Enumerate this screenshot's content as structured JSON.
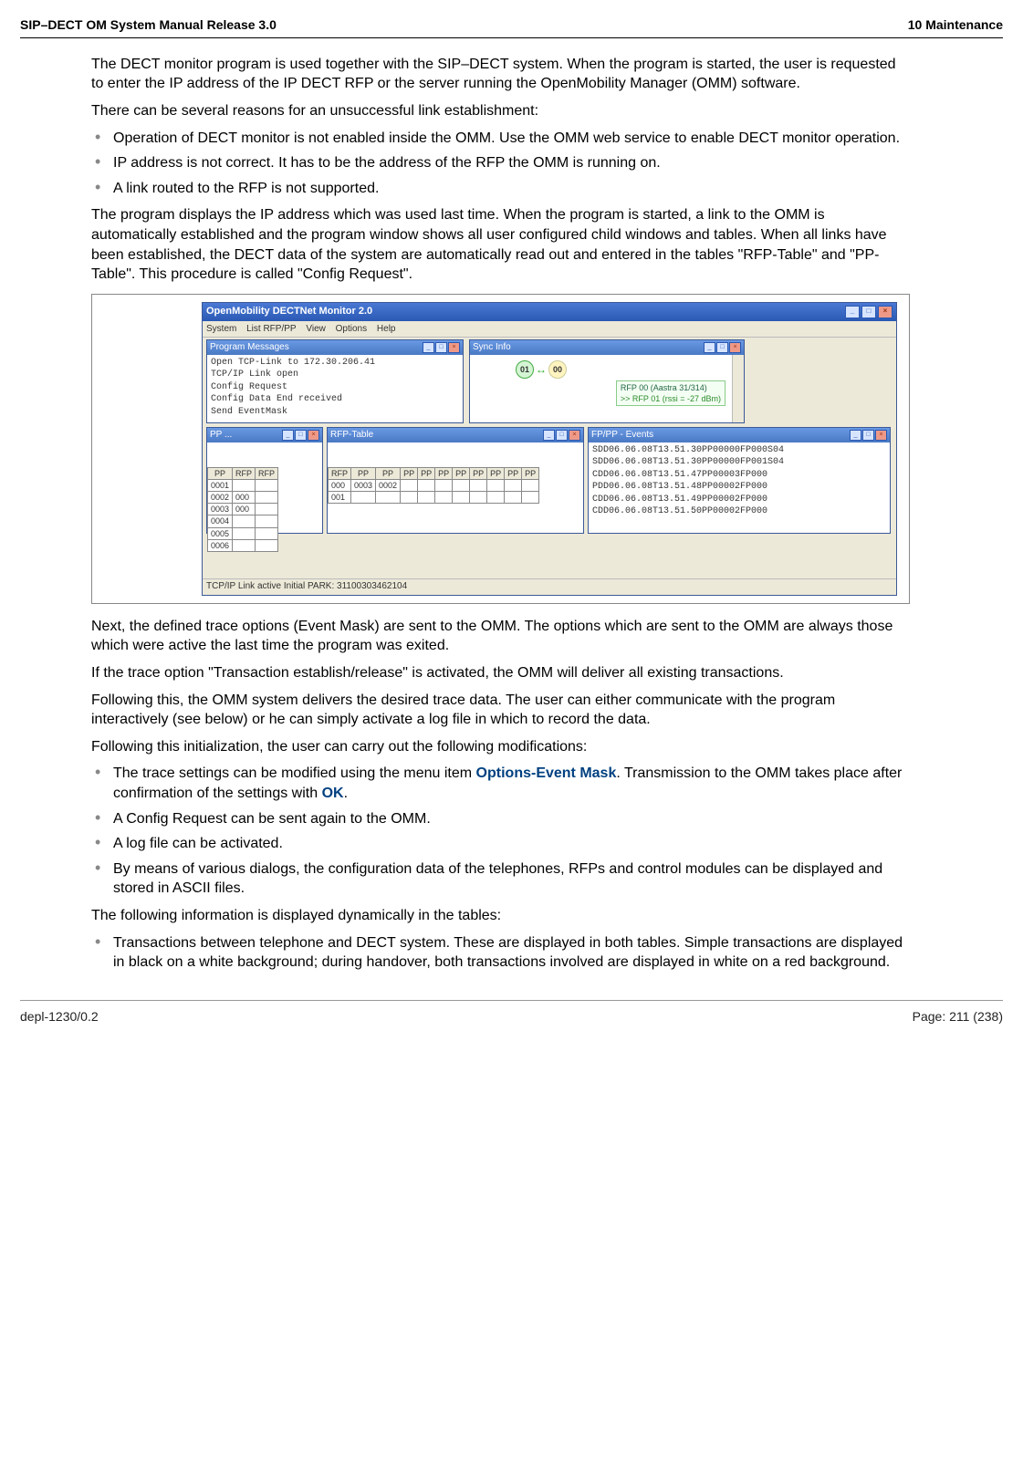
{
  "header": {
    "left": "SIP–DECT OM System Manual Release 3.0",
    "right": "10 Maintenance"
  },
  "footer": {
    "left": "depl-1230/0.2",
    "right": "Page: 211 (238)"
  },
  "p1": "The DECT monitor program is used together with the SIP–DECT system. When the program is started, the user is requested to enter the IP address of the IP DECT RFP or the server running the OpenMobility Manager (OMM) software.",
  "p2": "There can be several reasons for an unsuccessful link establishment:",
  "bullets1": {
    "a": "Operation of DECT monitor is not enabled inside the OMM. Use the OMM web service to enable DECT monitor operation.",
    "b": "IP address is not correct. It has to be the address of the RFP the OMM is running on.",
    "c": "A link routed to the RFP is not supported."
  },
  "p3": "The program displays the IP address which was used last time. When the program is started, a link to the OMM is automatically established and the program window shows all user configured child windows and tables. When all links have been established, the DECT data of the system are automatically read out and entered in the tables \"RFP-Table\" and \"PP-Table\". This procedure is called \"Config Request\".",
  "p4": "Next, the defined trace options (Event Mask) are sent to the OMM. The options which are sent to the OMM are always those which were active the last time the program was exited.",
  "p5": "If the trace option \"Transaction establish/release\" is activated, the OMM will deliver all existing transactions.",
  "p6": "Following this, the OMM system delivers the desired trace data. The user can either communicate with the program interactively (see below) or he can simply activate a log file in which to record the data.",
  "p7": "Following this initialization, the user can carry out the following modifications:",
  "bullets2": {
    "a_pre": "The trace settings can be modified using the menu item ",
    "a_b1": "Options-Event Mask",
    "a_mid": ". Transmission to the OMM takes place after confirmation of the settings with ",
    "a_b2": "OK",
    "a_post": ".",
    "b": "A Config Request can be sent again to the OMM.",
    "c": "A log file can be activated.",
    "d": "By means of various dialogs, the configuration data of the telephones, RFPs and control modules can be displayed and stored in ASCII files."
  },
  "p8": "The following information is displayed dynamically in the tables:",
  "bullets3": {
    "a": "Transactions between telephone and DECT system. These are displayed in both tables. Simple transactions are displayed in black on a white background; during handover, both transactions involved are displayed in white on a red background."
  },
  "screenshot": {
    "app_title": "OpenMobility DECTNet Monitor 2.0",
    "menu": {
      "system": "System",
      "list": "List RFP/PP",
      "view": "View",
      "options": "Options",
      "help": "Help"
    },
    "prog_msg": {
      "title": "Program Messages",
      "lines": "Open TCP-Link to 172.30.206.41\nTCP/IP Link open\nConfig Request\nConfig Data End received\nSend EventMask"
    },
    "sync": {
      "title": "Sync Info",
      "n1": "01",
      "n2": "00",
      "label_title": "RFP 00 (Aastra 31/314)",
      "label_sub": ">> RFP 01 (rssi = -27 dBm)"
    },
    "pp": {
      "title": "PP ...",
      "h1": "PP",
      "h2": "RFP",
      "h3": "RFP",
      "rows": {
        "r1a": "0001",
        "r1b": "",
        "r1c": "",
        "r2a": "0002",
        "r2b": "000",
        "r2c": "",
        "r3a": "0003",
        "r3b": "000",
        "r3c": "",
        "r4a": "0004",
        "r4b": "",
        "r4c": "",
        "r5a": "0005",
        "r5b": "",
        "r5c": "",
        "r6a": "0006",
        "r6b": "",
        "r6c": ""
      }
    },
    "rfp": {
      "title": "RFP-Table",
      "h1": "RFP",
      "h2": "PP",
      "h3": "PP",
      "h4": "PP",
      "h5": "PP",
      "h6": "PP",
      "h7": "PP",
      "h8": "PP",
      "h9": "PP",
      "h10": "PP",
      "h11": "PP",
      "rows": {
        "r1a": "000",
        "r1b": "0003",
        "r1c": "0002",
        "r2a": "001"
      }
    },
    "events": {
      "title": "FP/PP - Events",
      "lines": "SDD06.06.08T13.51.30PP00000FP000S04\nSDD06.06.08T13.51.30PP00000FP001S04\nCDD06.06.08T13.51.47PP00003FP000\nPDD06.06.08T13.51.48PP00002FP000\nCDD06.06.08T13.51.49PP00002FP000\nCDD06.06.08T13.51.50PP00002FP000"
    },
    "statusbar": "TCP/IP Link active  Initial PARK: 31100303462104"
  }
}
